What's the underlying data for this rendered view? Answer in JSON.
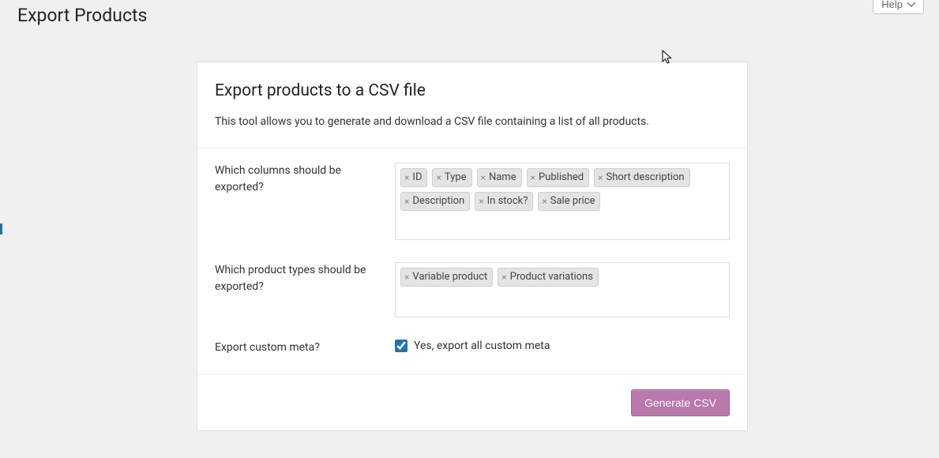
{
  "page": {
    "title": "Export Products",
    "help_label": "Help"
  },
  "panel": {
    "heading": "Export products to a CSV file",
    "description": "This tool allows you to generate and download a CSV file containing a list of all products."
  },
  "form": {
    "columns_label": "Which columns should be exported?",
    "columns_tags": [
      "ID",
      "Type",
      "Name",
      "Published",
      "Short description",
      "Description",
      "In stock?",
      "Sale price"
    ],
    "types_label": "Which product types should be exported?",
    "types_tags": [
      "Variable product",
      "Product variations"
    ],
    "custom_meta_label": "Export custom meta?",
    "custom_meta_checkbox_label": "Yes, export all custom meta",
    "custom_meta_checked": true
  },
  "footer": {
    "submit_label": "Generate CSV"
  }
}
